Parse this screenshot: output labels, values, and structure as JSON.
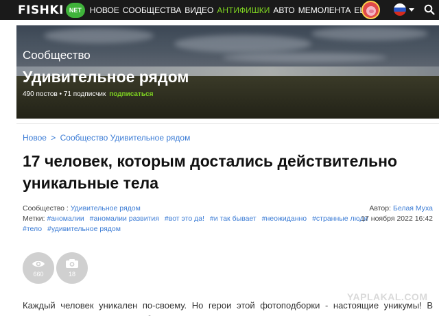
{
  "header": {
    "logo_text": "FISHKI",
    "logo_badge": "NET",
    "nav": [
      "НОВОЕ",
      "СООБЩЕСТВА",
      "ВИДЕО",
      "АНТИФИШКИ",
      "АВТО",
      "МЕМОЛЕНТА",
      "ЕЩЁ"
    ],
    "accent_color": "#7ed321",
    "icons": [
      "avatar-icon",
      "russian-flag-icon",
      "chevron-down-icon",
      "search-icon"
    ]
  },
  "banner": {
    "kicker": "Сообщество",
    "title": "Удивительное рядом",
    "stats": "490 постов • 71 подписчик",
    "subscribe": "подписаться"
  },
  "breadcrumb": {
    "home": "Новое",
    "sep": ">",
    "community": "Сообщество Удивительное рядом"
  },
  "article": {
    "title": "17 человек, которым достались действительно уникальные тела",
    "community_label": "Сообщество :",
    "community_value": "Удивительное рядом",
    "author_label": "Автор:",
    "author": "Белая Муха",
    "tags_label": "Метки:",
    "tags": [
      "#аномалии",
      "#аномалии развития",
      "#вот это да!",
      "#и так бывает",
      "#неожиданно",
      "#странные люди",
      "#тело",
      "#удивительное рядом"
    ],
    "date": "17 ноября 2022 16:42",
    "views": "660",
    "photos": "18",
    "body": "Каждый человек уникален по-своему. Но герои этой фотоподборки - настоящие уникумы! В прошлые времена они могли бы выступать в цирке и назывались \"курьезами природы\"!"
  },
  "watermark": "YAPLAKAL.COM"
}
